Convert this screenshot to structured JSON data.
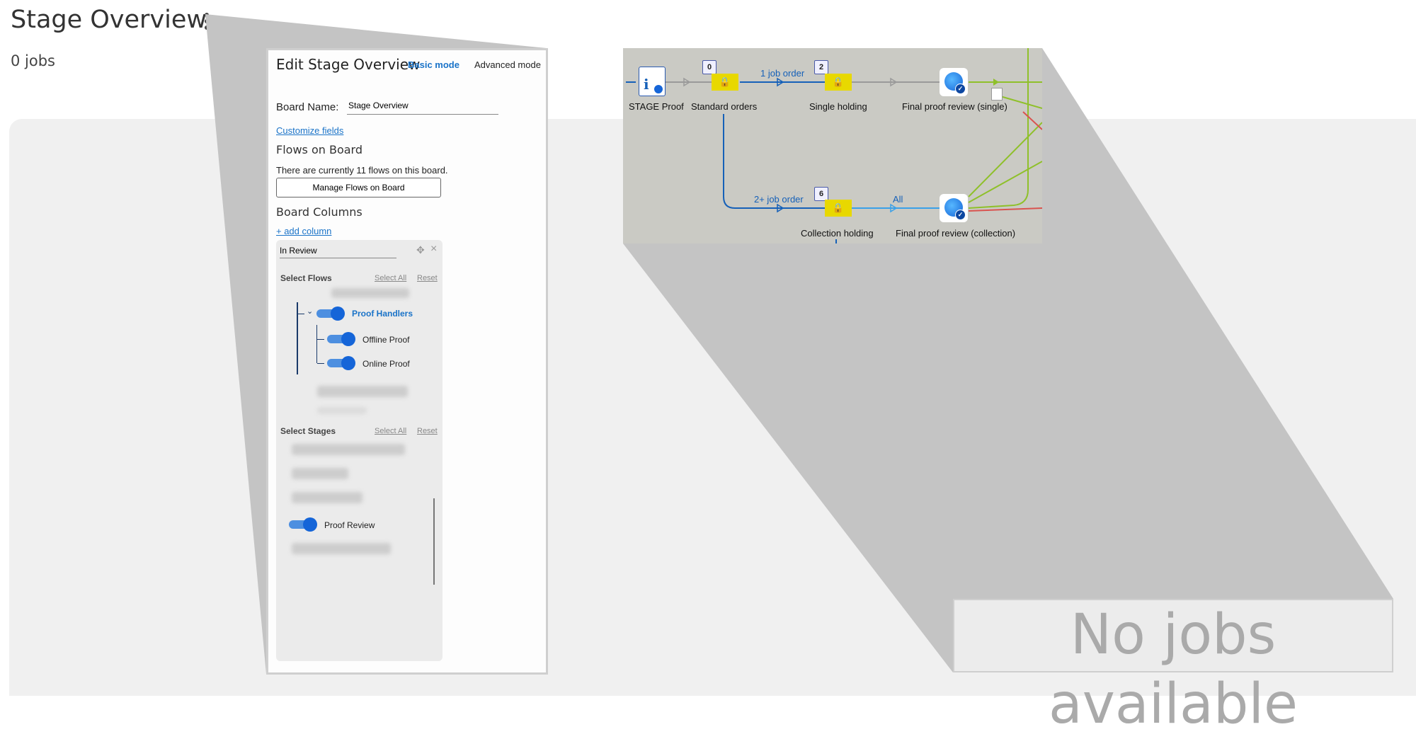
{
  "page": {
    "title": "Stage Overview",
    "job_count": "0 jobs",
    "empty_state": "No jobs available"
  },
  "edit_panel": {
    "title": "Edit Stage Overview",
    "mode_basic": "Basic mode",
    "mode_advanced": "Advanced mode",
    "board_name_label": "Board Name:",
    "board_name_value": "Stage Overview",
    "customize_fields": "Customize fields",
    "flows_heading": "Flows on Board",
    "flows_info": "There are currently 11 flows on this board.",
    "manage_flows_button": "Manage Flows on Board",
    "columns_heading": "Board Columns",
    "add_column": "+ add column",
    "column": {
      "name_value": "In Review",
      "select_flows_heading": "Select Flows",
      "select_all": "Select All",
      "reset": "Reset",
      "flow_group": {
        "label": "Proof Handlers",
        "enabled": true,
        "expanded": true
      },
      "flows": [
        {
          "label": "Offline Proof",
          "enabled": true
        },
        {
          "label": "Online Proof",
          "enabled": true
        }
      ],
      "select_stages_heading": "Select Stages",
      "stages": [
        {
          "label": "Proof Review",
          "enabled": true
        }
      ]
    }
  },
  "flow_diagram": {
    "nodes": {
      "stage_proof": "STAGE Proof",
      "standard_orders": "Standard orders",
      "single_holding": "Single holding",
      "final_single": "Final proof review (single)",
      "collection_holding": "Collection holding",
      "final_collection": "Final proof review (collection)"
    },
    "counts": {
      "standard_orders": "0",
      "single_holding": "2",
      "collection_holding": "6"
    },
    "edges": {
      "one_job": "1 job order",
      "two_plus": "2+ job order",
      "all": "All"
    },
    "colors": {
      "blue": "#1560b8",
      "green": "#8fc02a",
      "red": "#d9534f",
      "gray": "#9a9a9a",
      "hold": "#e8d800"
    }
  }
}
